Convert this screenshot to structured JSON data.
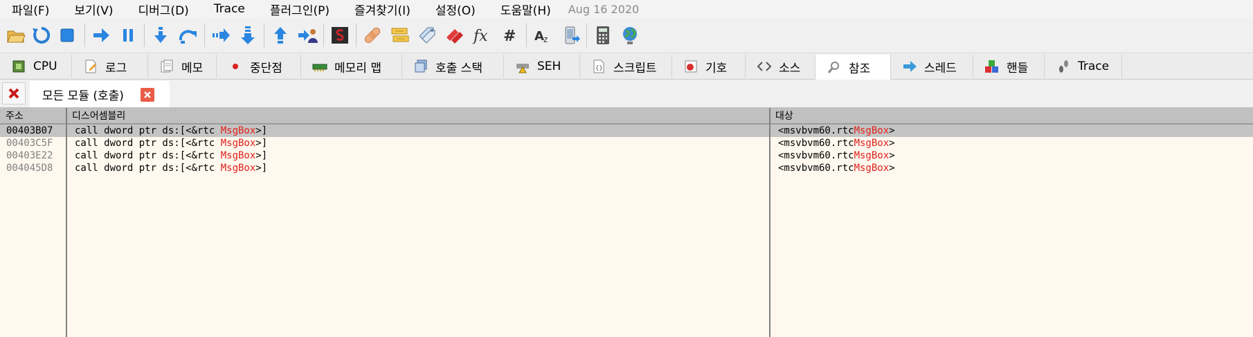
{
  "menu": {
    "items": [
      "파일(F)",
      "보기(V)",
      "디버그(D)",
      "Trace",
      "플러그인(P)",
      "즐겨찾기(I)",
      "설정(O)",
      "도움말(H)"
    ],
    "date": "Aug 16 2020"
  },
  "toolbar": {
    "icons": [
      "open-icon",
      "restart-icon",
      "stop-icon",
      "run-icon",
      "pause-icon",
      "step-into-icon",
      "step-over-icon",
      "trace-into-icon",
      "trace-over-icon",
      "execute-till-return-icon",
      "run-to-user-code-icon",
      "scylla-icon",
      "patch-icon",
      "comments-icon",
      "labels-icon",
      "bookmarks-icon",
      "functions-icon",
      "variables-icon",
      "strings-icon",
      "mobile-icon",
      "calculator-icon",
      "globe-icon"
    ]
  },
  "tabs": [
    {
      "label": "CPU",
      "icon": "cpu-icon"
    },
    {
      "label": "로그",
      "icon": "log-icon"
    },
    {
      "label": "메모",
      "icon": "notes-icon"
    },
    {
      "label": "중단점",
      "icon": "breakpoint-icon"
    },
    {
      "label": "메모리 맵",
      "icon": "memory-map-icon"
    },
    {
      "label": "호출 스택",
      "icon": "call-stack-icon"
    },
    {
      "label": "SEH",
      "icon": "seh-icon"
    },
    {
      "label": "스크립트",
      "icon": "script-icon"
    },
    {
      "label": "기호",
      "icon": "symbols-icon"
    },
    {
      "label": "소스",
      "icon": "source-icon"
    },
    {
      "label": "참조",
      "icon": "references-icon",
      "active": true
    },
    {
      "label": "스레드",
      "icon": "threads-icon"
    },
    {
      "label": "핸들",
      "icon": "handles-icon"
    },
    {
      "label": "Trace",
      "icon": "trace-icon"
    }
  ],
  "subtab": {
    "label": "모든 모듈 (호출)"
  },
  "table": {
    "headers": {
      "address": "주소",
      "disassembly": "디스어셈블리",
      "target": "대상"
    },
    "rows": [
      {
        "address": "00403B07",
        "dis_prefix": "call dword ptr ds:[<&rtc ",
        "dis_highlight": "MsgBox",
        "dis_suffix": ">]",
        "tgt_prefix": "<msvbvm60.rtc",
        "tgt_highlight": "MsgBox",
        "tgt_suffix": ">",
        "selected": true
      },
      {
        "address": "00403C5F",
        "dis_prefix": "call dword ptr ds:[<&rtc ",
        "dis_highlight": "MsgBox",
        "dis_suffix": ">]",
        "tgt_prefix": "<msvbvm60.rtc",
        "tgt_highlight": "MsgBox",
        "tgt_suffix": ">",
        "selected": false
      },
      {
        "address": "00403E22",
        "dis_prefix": "call dword ptr ds:[<&rtc ",
        "dis_highlight": "MsgBox",
        "dis_suffix": ">]",
        "tgt_prefix": "<msvbvm60.rtc",
        "tgt_highlight": "MsgBox",
        "tgt_suffix": ">",
        "selected": false
      },
      {
        "address": "004045D8",
        "dis_prefix": "call dword ptr ds:[<&rtc ",
        "dis_highlight": "MsgBox",
        "dis_suffix": ">]",
        "tgt_prefix": "<msvbvm60.rtc",
        "tgt_highlight": "MsgBox",
        "tgt_suffix": ">",
        "selected": false
      }
    ]
  },
  "colors": {
    "highlight": "#e0201b",
    "background": "#fff8ee",
    "selected_row": "#c4c4c4",
    "header": "#c0c0c0"
  }
}
